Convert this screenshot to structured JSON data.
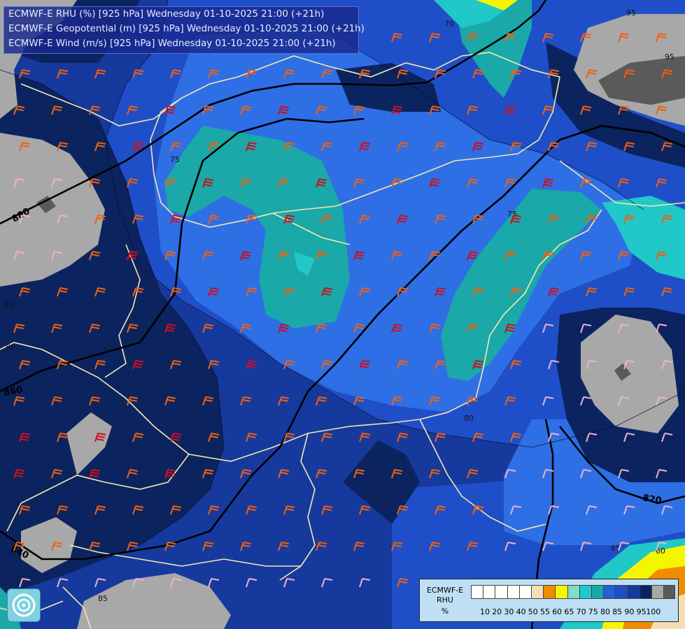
{
  "header": {
    "line1": "ECMWF-E RHU (%) [925 hPa] Wednesday 01-10-2025 21:00 (+21h)",
    "line2": "ECMWF-E Geopotential (m) [925 hPa] Wednesday 01-10-2025 21:00 (+21h)",
    "line3": "ECMWF-E Wind (m/s) [925 hPa] Wednesday 01-10-2025 21:00 (+21h)"
  },
  "legend": {
    "title1": "ECMWF-E",
    "title2": "RHU",
    "unit": "%",
    "colors": [
      "#ffffff",
      "#ffffff",
      "#ffffff",
      "#ffffff",
      "#ffffff",
      "#f5deb3",
      "#f08c00",
      "#f5f500",
      "#80dccc",
      "#20c8c8",
      "#1aa8a8",
      "#2060d8",
      "#1f4fc8",
      "#16399e",
      "#0b2460",
      "#a8a8a8",
      "#5a5a5a"
    ],
    "ticks": [
      "10",
      "20",
      "30",
      "40",
      "50",
      "55",
      "60",
      "65",
      "70",
      "75",
      "80",
      "85",
      "90",
      "95",
      "100"
    ]
  },
  "isohypses": [
    "880",
    "860",
    "840",
    "820"
  ],
  "contour_labels": [
    "95",
    "95",
    "70",
    "75",
    "75",
    "85",
    "80",
    "60",
    "65",
    "85",
    "80",
    "95",
    "95"
  ],
  "colors": {
    "rhu_100": "#5a5a5a",
    "rhu_95": "#a8a8a8",
    "rhu_90": "#0b2460",
    "rhu_85": "#16399e",
    "rhu_80": "#1f4fc8",
    "rhu_75": "#2e6fe6",
    "rhu_70": "#1aa8a8",
    "rhu_65": "#20c8c8",
    "rhu_60": "#f5f500",
    "rhu_55": "#f08c00",
    "borders": "#f5e8b0",
    "wind_red": "#cc1020",
    "wind_orange": "#f06010",
    "wind_pink": "#f0b0d0"
  }
}
